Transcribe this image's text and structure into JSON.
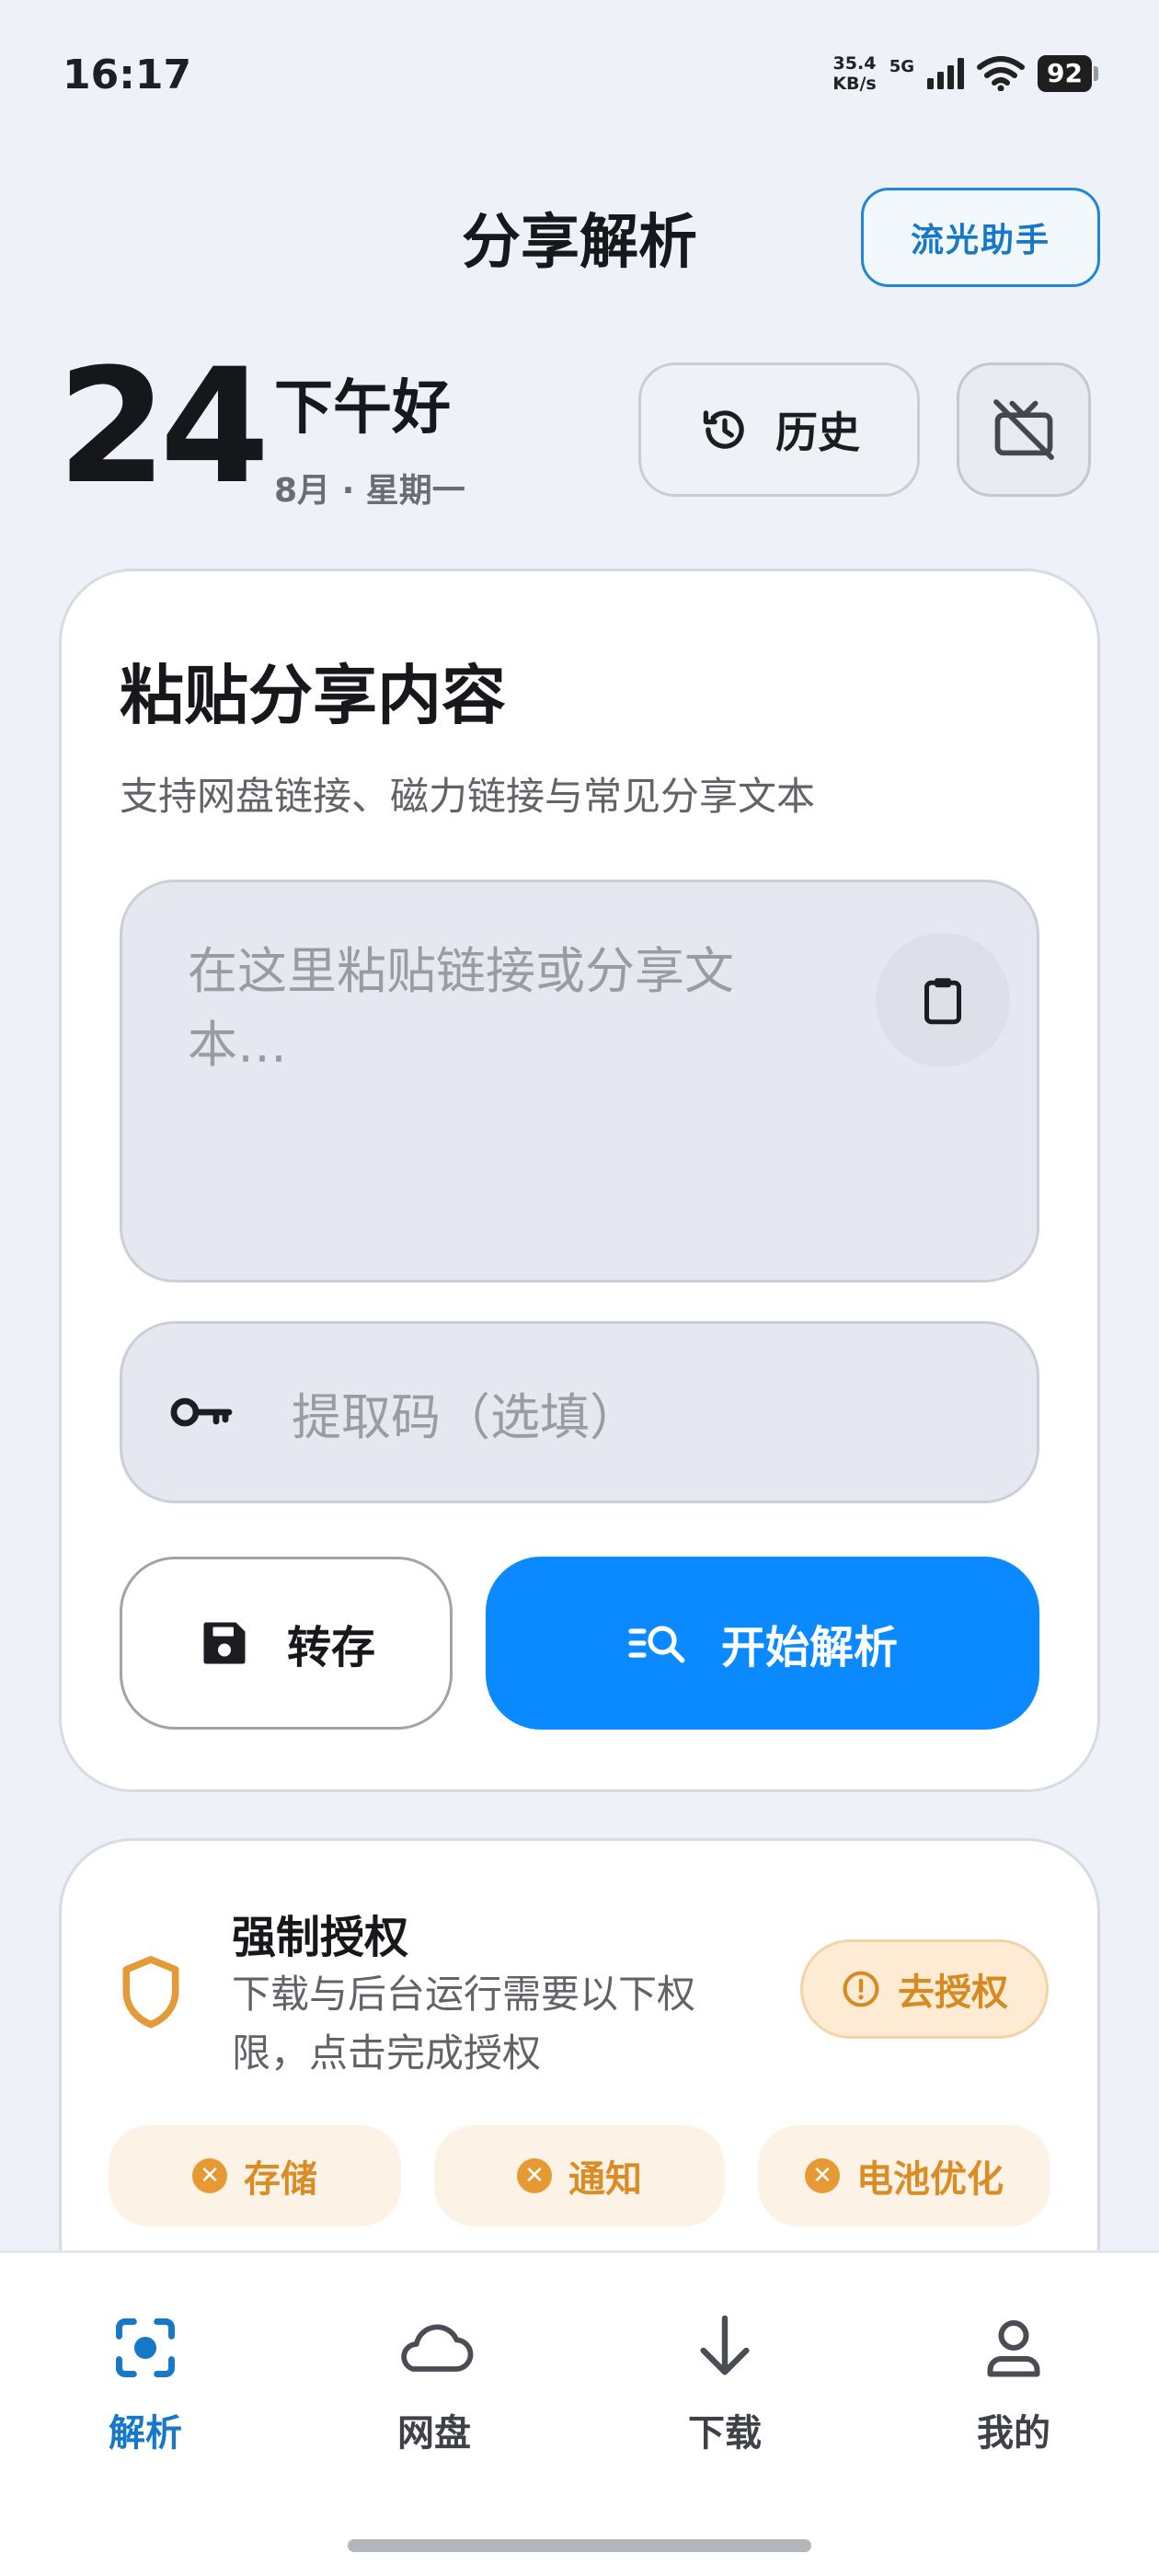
{
  "status_bar": {
    "time": "16:17",
    "net_speed_value": "35.4",
    "net_speed_unit": "KB/s",
    "network": "5G",
    "battery": "92"
  },
  "header": {
    "title": "分享解析",
    "assistant_button": "流光助手"
  },
  "date": {
    "day": "24",
    "greeting": "下午好",
    "sub": "8月 · 星期一",
    "history_button": "历史"
  },
  "share_card": {
    "title": "粘贴分享内容",
    "subtitle": "支持网盘链接、磁力链接与常见分享文本",
    "paste_placeholder": "在这里粘贴链接或分享文本…",
    "code_placeholder": "提取码（选填）",
    "save_button": "转存",
    "parse_button": "开始解析"
  },
  "permission_card": {
    "title": "强制授权",
    "description": "下载与后台运行需要以下权限，点击完成授权",
    "grant_button": "去授权",
    "chips": [
      "存储",
      "通知",
      "电池优化"
    ]
  },
  "bottom_nav": {
    "active": "解析",
    "items": [
      "解析",
      "网盘",
      "下载",
      "我的"
    ]
  },
  "colors": {
    "accent_blue": "#0b8aff",
    "nav_active": "#1778c8",
    "warning_orange": "#d98d24",
    "background": "#eef2f8"
  },
  "icons": [
    "history-icon",
    "tv-off-icon",
    "clipboard-icon",
    "key-icon",
    "save-icon",
    "search-list-icon",
    "shield-icon",
    "alert-circle-icon",
    "close-circle-icon",
    "scan-icon",
    "cloud-icon",
    "download-icon",
    "user-icon"
  ]
}
